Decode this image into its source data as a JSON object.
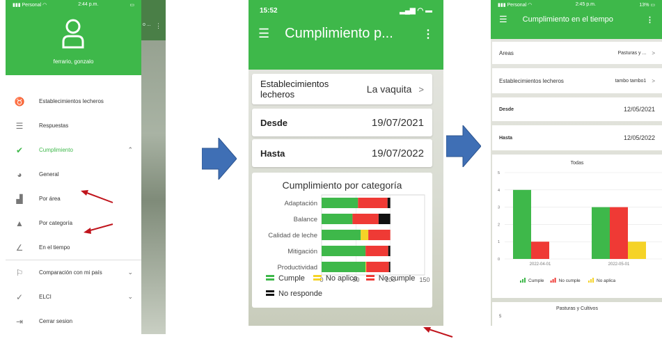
{
  "phone1": {
    "status": {
      "carrier": "Personal",
      "time": "2:44 p.m.",
      "battery": "13%"
    },
    "user_name": "ferrario, gonzalo",
    "menu": [
      {
        "label": "Establecimientos lecheros",
        "icon": "cow-icon"
      },
      {
        "label": "Respuestas",
        "icon": "checklist-icon"
      },
      {
        "label": "Cumplimiento",
        "icon": "double-check-icon",
        "active": true,
        "expand": "^"
      },
      {
        "label": "General",
        "icon": "pie-chart-icon"
      },
      {
        "label": "Por área",
        "icon": "area-chart-icon"
      },
      {
        "label": "Por categoría",
        "icon": "category-icon"
      },
      {
        "label": "En el tiempo",
        "icon": "line-chart-icon"
      },
      {
        "label": "Comparación con mi país",
        "icon": "flag-icon",
        "expand": "v"
      },
      {
        "label": "ELCI",
        "icon": "check-icon",
        "expand": "v"
      },
      {
        "label": "Cerrar sesion",
        "icon": "logout-icon"
      }
    ],
    "bg_partial_title": "o ..."
  },
  "phone2": {
    "status": {
      "time": "15:52"
    },
    "title": "Cumplimiento p...",
    "fields": [
      {
        "label": "Establecimientos lecheros",
        "value": "La vaquita",
        "chevron": ">"
      },
      {
        "label": "Desde",
        "value": "19/07/2021"
      },
      {
        "label": "Hasta",
        "value": "19/07/2022"
      }
    ],
    "legend": [
      {
        "label": "Cumple",
        "color": "#3eb84a"
      },
      {
        "label": "No aplica",
        "color": "#f5d327"
      },
      {
        "label": "No cumple",
        "color": "#ef3a35"
      },
      {
        "label": "No responde",
        "color": "#111111"
      }
    ]
  },
  "phone3": {
    "status": {
      "carrier": "Personal",
      "time": "2:45 p.m.",
      "battery": "13%"
    },
    "title": "Cumplimiento en el tiempo",
    "fields": [
      {
        "label": "Areas",
        "value": "Pasturas y ...",
        "chevron": ">"
      },
      {
        "label": "Establecimientos lecheros",
        "value": "tambo tambo1",
        "chevron": ">"
      },
      {
        "label": "Desde",
        "value": "12/05/2021"
      },
      {
        "label": "Hasta",
        "value": "12/05/2022"
      }
    ],
    "legend": [
      {
        "label": "Cumple",
        "color": "#3eb84a"
      },
      {
        "label": "No cumple",
        "color": "#ef3a35"
      },
      {
        "label": "No aplica",
        "color": "#f5d327"
      }
    ],
    "second_chart_title": "Pasturas y Cultivos",
    "second_chart_ytick": "5"
  },
  "chart_data": [
    {
      "type": "bar",
      "orientation": "horizontal-stacked",
      "title": "Cumplimiento por categoría",
      "categories": [
        "Adaptación",
        "Balance",
        "Calidad de leche",
        "Mitigación",
        "Productividad"
      ],
      "series": [
        {
          "name": "Cumple",
          "values": [
            53,
            45,
            57,
            64,
            64
          ]
        },
        {
          "name": "No aplica",
          "values": [
            0,
            0,
            11,
            0,
            1
          ]
        },
        {
          "name": "No cumple",
          "values": [
            43,
            38,
            32,
            33,
            33
          ]
        },
        {
          "name": "No responde",
          "values": [
            4,
            17,
            0,
            3,
            2
          ]
        }
      ],
      "xticks": [
        "0",
        "50",
        "100",
        "150"
      ],
      "xlim": [
        0,
        150
      ]
    },
    {
      "type": "bar",
      "title": "Todas",
      "categories": [
        "2022-04-01",
        "2022-05-01"
      ],
      "series": [
        {
          "name": "Cumple",
          "values": [
            4,
            3
          ]
        },
        {
          "name": "No cumple",
          "values": [
            1,
            3
          ]
        },
        {
          "name": "No aplica",
          "values": [
            0,
            1
          ]
        }
      ],
      "yticks": [
        "0",
        "1",
        "2",
        "3",
        "4",
        "5"
      ],
      "ylim": [
        0,
        5
      ]
    }
  ]
}
